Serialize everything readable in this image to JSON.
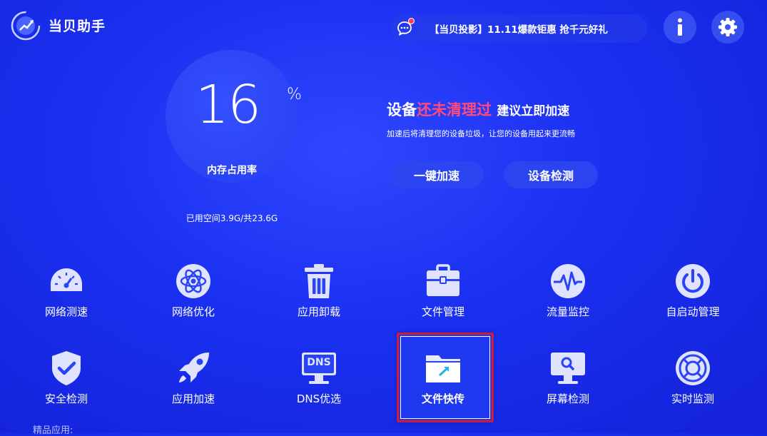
{
  "app": {
    "title": "当贝助手"
  },
  "header": {
    "promo_text": "【当贝投影】11.11爆款钜惠 抢千元好礼",
    "chat_icon": "chat-bubble-icon",
    "info_icon": "info-icon",
    "settings_icon": "gear-icon"
  },
  "memory": {
    "value": "16",
    "unit": "%",
    "label": "内存占用率",
    "storage": "已用空间3.9G/共23.6G"
  },
  "status": {
    "title_prefix": "设备",
    "title_highlight": "还未清理过",
    "title_suffix": "建议立即加速",
    "description": "加速后将清理您的设备垃圾，让您的设备用起来更流畅",
    "buttons": {
      "accelerate": "一键加速",
      "check": "设备检测"
    }
  },
  "tools": {
    "row1": [
      {
        "label": "网络测速",
        "icon": "speedometer-icon"
      },
      {
        "label": "网络优化",
        "icon": "atom-icon"
      },
      {
        "label": "应用卸载",
        "icon": "trash-icon"
      },
      {
        "label": "文件管理",
        "icon": "briefcase-icon"
      },
      {
        "label": "流量监控",
        "icon": "pulse-icon"
      },
      {
        "label": "自启动管理",
        "icon": "power-icon"
      }
    ],
    "row2": [
      {
        "label": "安全检测",
        "icon": "shield-check-icon"
      },
      {
        "label": "应用加速",
        "icon": "rocket-icon"
      },
      {
        "label": "DNS优选",
        "icon": "dns-monitor-icon",
        "icon_text": "DNS"
      },
      {
        "label": "文件快传",
        "icon": "folder-transfer-icon",
        "selected": true
      },
      {
        "label": "屏幕检测",
        "icon": "monitor-search-icon"
      },
      {
        "label": "实时监测",
        "icon": "lifebuoy-icon"
      }
    ]
  },
  "section": {
    "featured_apps": "精品应用:"
  },
  "colors": {
    "background": "#1a2ff0",
    "warning": "#ff4a7a",
    "selection": "#d21a3a",
    "icon": "#dfe3ff"
  }
}
